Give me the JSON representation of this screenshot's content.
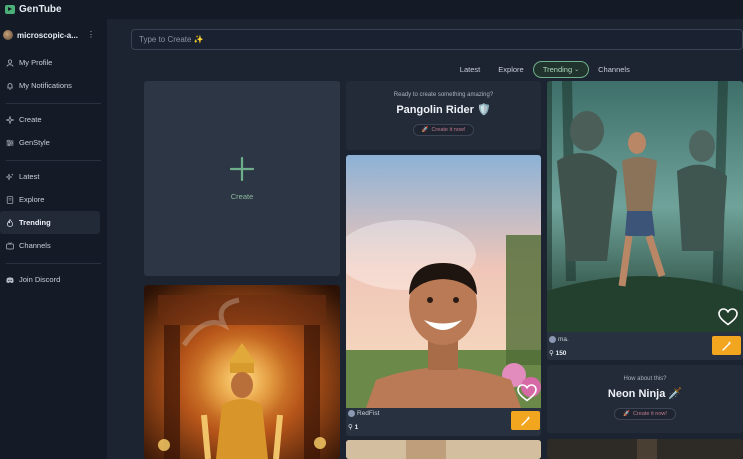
{
  "app": {
    "brand": "GenTube"
  },
  "sidebar": {
    "username": "microscopic-a...",
    "items": [
      {
        "label": "My Profile",
        "icon": "user-icon"
      },
      {
        "label": "My Notifications",
        "icon": "bell-icon"
      },
      {
        "label": "Create",
        "icon": "sparkle-icon"
      },
      {
        "label": "GenStyle",
        "icon": "sliders-icon"
      },
      {
        "label": "Latest",
        "icon": "sparkles-icon"
      },
      {
        "label": "Explore",
        "icon": "book-icon"
      },
      {
        "label": "Trending",
        "icon": "flame-icon"
      },
      {
        "label": "Channels",
        "icon": "tv-icon"
      },
      {
        "label": "Join Discord",
        "icon": "discord-icon"
      }
    ]
  },
  "search": {
    "placeholder": "Type to Create ✨"
  },
  "tabs": {
    "latest": "Latest",
    "explore": "Explore",
    "trending": "Trending",
    "channels": "Channels"
  },
  "create_card": {
    "label": "Create"
  },
  "prompt1": {
    "small": "Ready to create something amazing?",
    "title": "Pangolin Rider 🛡️",
    "button": "Create it now!"
  },
  "prompt2": {
    "small": "How about this?",
    "title": "Neon Ninja 🗡️",
    "button": "Create it now!"
  },
  "posts": [
    {
      "author": "RedFist",
      "count": "1"
    },
    {
      "author": "ma.",
      "count": "150"
    }
  ],
  "colors": {
    "accent": "#6fae8a",
    "action": "#f2a51f",
    "bg": "#1c2331",
    "sidebar": "#151b26"
  }
}
